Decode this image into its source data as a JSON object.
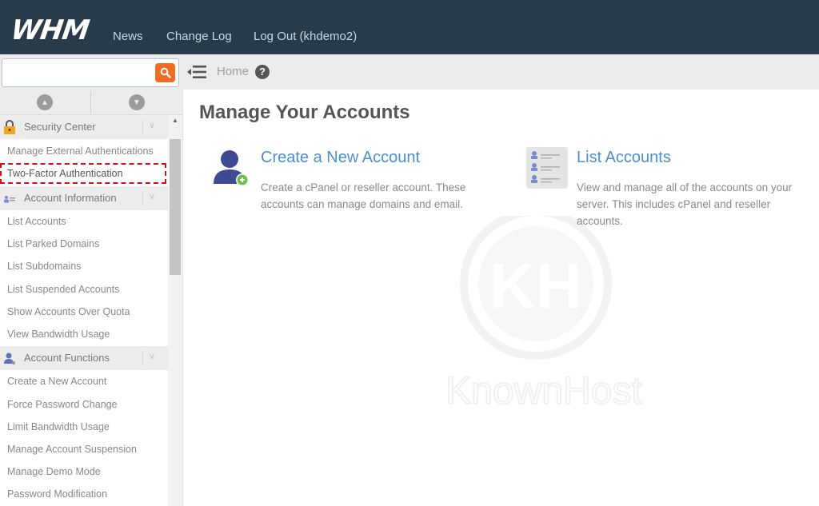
{
  "header": {
    "logo": "WHM",
    "nav": [
      "News",
      "Change Log",
      "Log Out (khdemo2)"
    ]
  },
  "search": {
    "value": "",
    "placeholder": ""
  },
  "breadcrumb": {
    "home": "Home"
  },
  "sidebar": {
    "categories": [
      {
        "label": "Security Center",
        "icon": "lock-icon",
        "items": [
          "Manage External Authentications",
          "Two-Factor Authentication"
        ]
      },
      {
        "label": "Account Information",
        "icon": "account-info-icon",
        "items": [
          "List Accounts",
          "List Parked Domains",
          "List Subdomains",
          "List Suspended Accounts",
          "Show Accounts Over Quota",
          "View Bandwidth Usage"
        ]
      },
      {
        "label": "Account Functions",
        "icon": "user-icon",
        "items": [
          "Create a New Account",
          "Force Password Change",
          "Limit Bandwidth Usage",
          "Manage Account Suspension",
          "Manage Demo Mode",
          "Password Modification"
        ]
      }
    ],
    "highlighted_item": "Two-Factor Authentication"
  },
  "main": {
    "title": "Manage Your Accounts",
    "cards": [
      {
        "title": "Create a New Account",
        "description_lines": [
          "Create a cPanel or reseller account. These",
          "accounts can manage domains and email."
        ]
      },
      {
        "title": "List Accounts",
        "description_lines": [
          "View and manage all of the accounts on your",
          "server. This includes cPanel and reseller",
          "accounts."
        ]
      }
    ]
  },
  "watermark": {
    "text": "KnownHost",
    "monogram": "KH"
  },
  "colors": {
    "topbar": "#293a4a",
    "search_button": "#f26d21",
    "link": "#4a90d0",
    "highlight": "#d0101a"
  }
}
